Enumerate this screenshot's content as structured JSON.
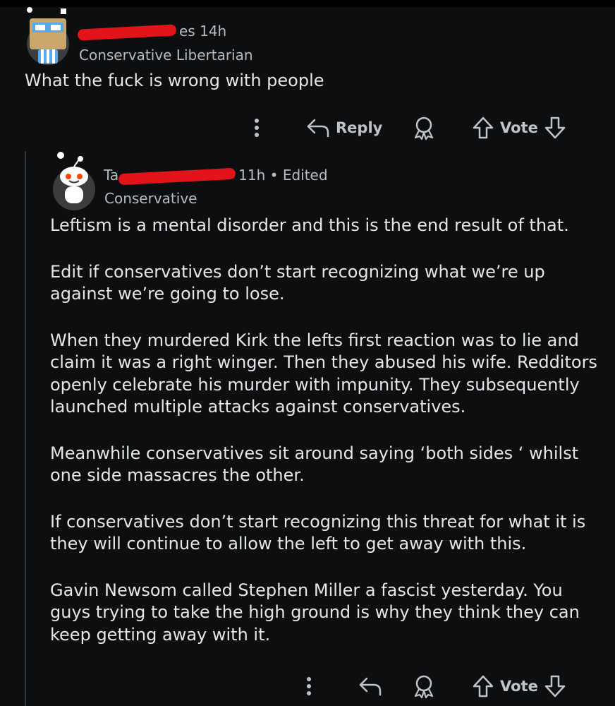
{
  "comment_1": {
    "username_visible_fragment": "es",
    "time": "14h",
    "flair": "Conservative Libertarian",
    "body": "What the fuck is wrong with people",
    "actions": {
      "reply_label": "Reply",
      "vote_label": "Vote"
    }
  },
  "comment_2": {
    "username_prefix": "Ta",
    "time": "11h",
    "separator": "•",
    "edited": "Edited",
    "flair": "Conservative",
    "paragraphs": [
      "Leftism is a mental disorder and this is the end result of that.",
      "Edit if conservatives don’t start recognizing what we’re up against we’re going to lose.",
      "When they murdered Kirk the lefts first reaction was to lie and claim it was a right winger. Then they abused his wife. Redditors openly celebrate his murder with impunity. They subsequently launched multiple attacks against conservatives.",
      "Meanwhile conservatives sit around saying ‘both sides ‘ whilst one side massacres the other.",
      "If conservatives don’t start recognizing this threat for what it is they will continue to allow the left to get away with this.",
      "Gavin Newsom called Stephen Miller a fascist yesterday. You guys trying to take the high ground is why they think they can keep getting away with it."
    ],
    "actions": {
      "vote_label": "Vote"
    }
  },
  "colors": {
    "background": "#0c0e10",
    "text": "#e4e6e8",
    "meta_text": "#b8bcbf",
    "redaction": "#e3131a",
    "thread_line": "#33373a"
  },
  "icons": [
    "more-options-icon",
    "reply-icon",
    "award-icon",
    "upvote-icon",
    "downvote-icon"
  ]
}
